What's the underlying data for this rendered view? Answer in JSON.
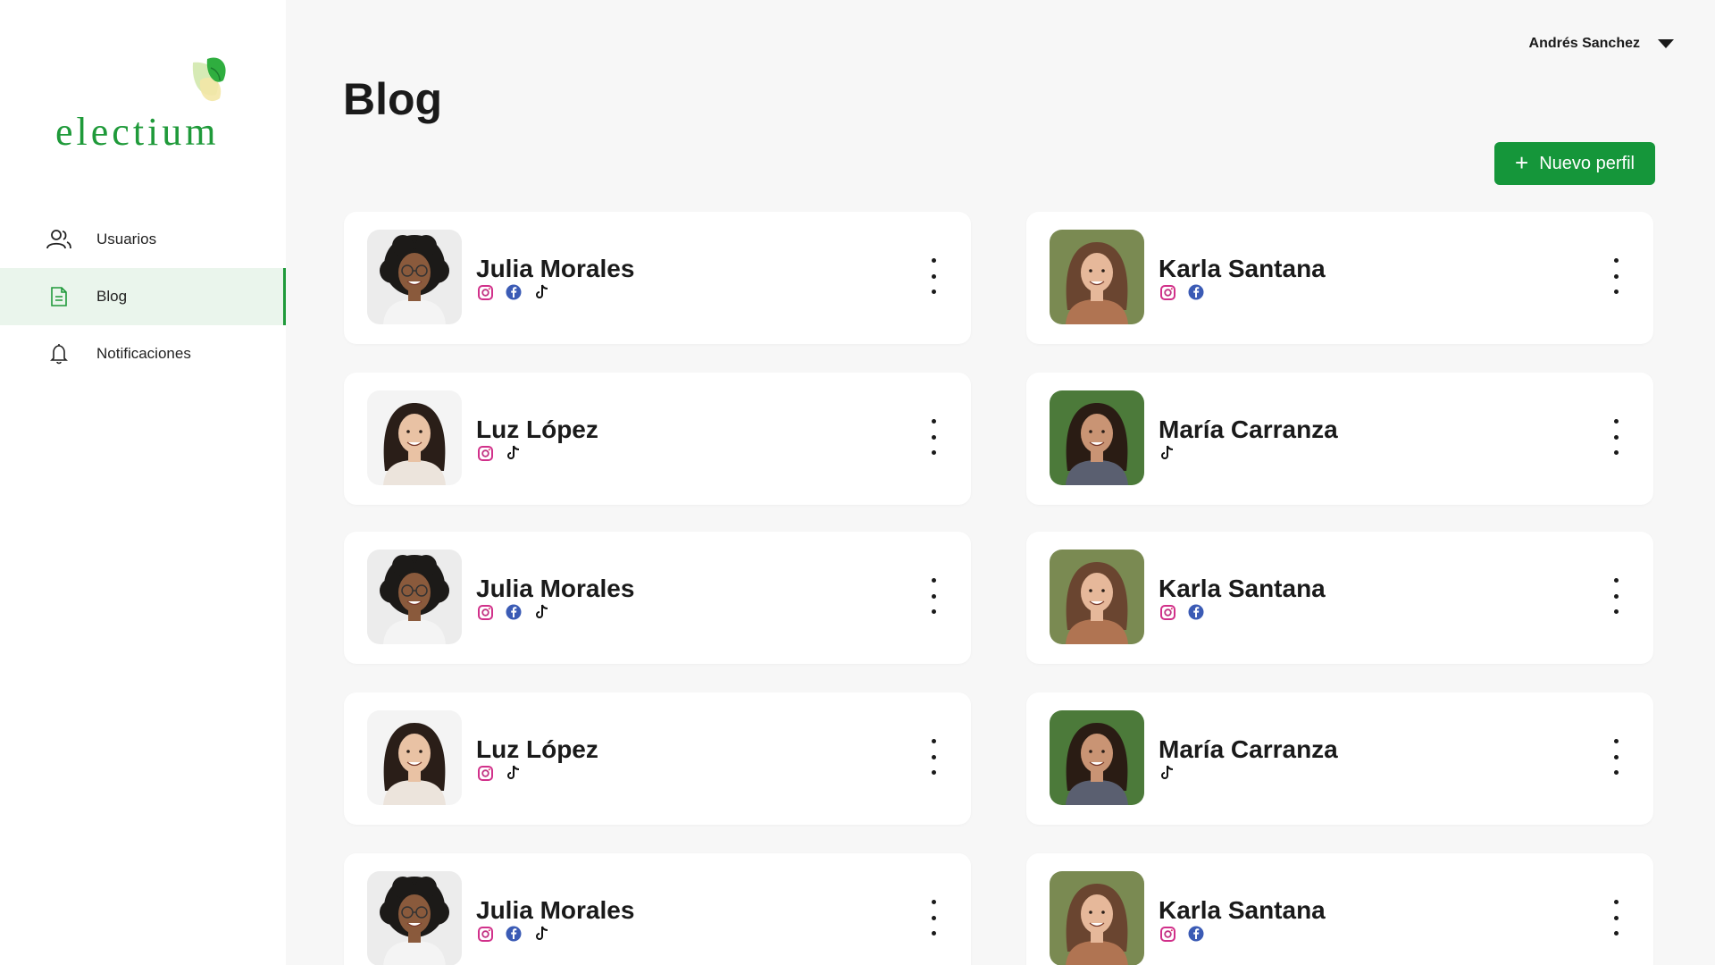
{
  "brand": {
    "name": "electium",
    "colors": {
      "accent": "#15963a",
      "active_bg": "#eaf5ec",
      "page_bg": "#f7f7f7"
    }
  },
  "sidebar": {
    "items": [
      {
        "label": "Usuarios",
        "icon": "users-icon",
        "active": false
      },
      {
        "label": "Blog",
        "icon": "document-icon",
        "active": true
      },
      {
        "label": "Notificaciones",
        "icon": "bell-icon",
        "active": false
      }
    ]
  },
  "header": {
    "user_name": "Andrés Sanchez"
  },
  "main": {
    "title": "Blog",
    "new_button_label": "Nuevo perfil",
    "profiles": [
      {
        "name": "Julia Morales",
        "socials": [
          "instagram",
          "facebook",
          "tiktok"
        ],
        "avatar": "curly-hair-glasses"
      },
      {
        "name": "Karla Santana",
        "socials": [
          "instagram",
          "facebook"
        ],
        "avatar": "brown-hair"
      },
      {
        "name": "Luz López",
        "socials": [
          "instagram",
          "tiktok"
        ],
        "avatar": "dark-wavy-hair"
      },
      {
        "name": "María Carranza",
        "socials": [
          "tiktok"
        ],
        "avatar": "dark-hair-smile"
      },
      {
        "name": "Julia Morales",
        "socials": [
          "instagram",
          "facebook",
          "tiktok"
        ],
        "avatar": "curly-hair-glasses"
      },
      {
        "name": "Karla Santana",
        "socials": [
          "instagram",
          "facebook"
        ],
        "avatar": "brown-hair"
      },
      {
        "name": "Luz López",
        "socials": [
          "instagram",
          "tiktok"
        ],
        "avatar": "dark-wavy-hair"
      },
      {
        "name": "María Carranza",
        "socials": [
          "tiktok"
        ],
        "avatar": "dark-hair-smile"
      },
      {
        "name": "Julia Morales",
        "socials": [
          "instagram",
          "facebook",
          "tiktok"
        ],
        "avatar": "curly-hair-glasses"
      },
      {
        "name": "Karla Santana",
        "socials": [
          "instagram",
          "facebook"
        ],
        "avatar": "brown-hair"
      }
    ]
  }
}
